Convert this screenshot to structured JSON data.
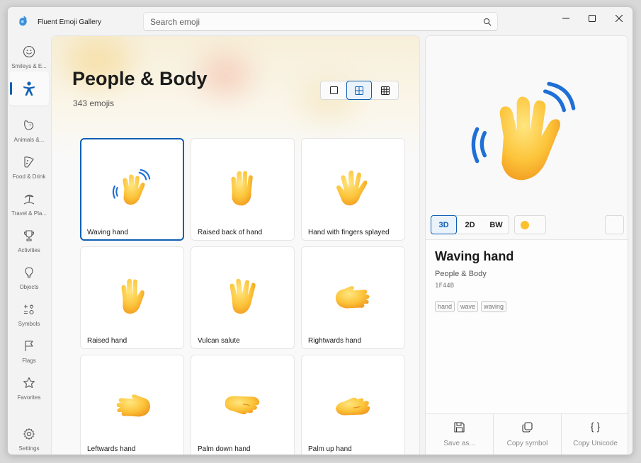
{
  "window": {
    "title": "Fluent Emoji Gallery"
  },
  "search": {
    "placeholder": "Search emoji"
  },
  "nav": {
    "items": [
      {
        "label": "Smileys & E...",
        "icon": "smiley-icon"
      },
      {
        "label": "",
        "icon": "person-icon",
        "active": true
      },
      {
        "label": "Animals &...",
        "icon": "animal-icon"
      },
      {
        "label": "Food & Drink",
        "icon": "food-icon"
      },
      {
        "label": "Travel & Pla...",
        "icon": "travel-icon"
      },
      {
        "label": "Activities",
        "icon": "trophy-icon"
      },
      {
        "label": "Objects",
        "icon": "lightbulb-icon"
      },
      {
        "label": "Symbols",
        "icon": "symbols-icon"
      },
      {
        "label": "Flags",
        "icon": "flag-icon"
      },
      {
        "label": "Favorites",
        "icon": "star-icon"
      }
    ],
    "settings_label": "Settings"
  },
  "main": {
    "title": "People & Body",
    "count": "343 emojis",
    "view_modes": [
      "large-view-icon",
      "medium-view-icon",
      "small-view-icon"
    ],
    "selected_view": "medium",
    "emojis": [
      {
        "label": "Waving hand",
        "icon": "waving-hand-icon",
        "selected": true
      },
      {
        "label": "Raised back of hand",
        "icon": "raised-back-of-hand-icon"
      },
      {
        "label": "Hand with fingers splayed",
        "icon": "hand-fingers-splayed-icon"
      },
      {
        "label": "Raised hand",
        "icon": "raised-hand-icon"
      },
      {
        "label": "Vulcan salute",
        "icon": "vulcan-salute-icon"
      },
      {
        "label": "Rightwards hand",
        "icon": "rightwards-hand-icon"
      },
      {
        "label": "Leftwards hand",
        "icon": "leftwards-hand-icon"
      },
      {
        "label": "Palm down hand",
        "icon": "palm-down-hand-icon"
      },
      {
        "label": "Palm up hand",
        "icon": "palm-up-hand-icon"
      }
    ]
  },
  "details": {
    "styles": [
      "3D",
      "2D",
      "BW"
    ],
    "selected_style": "3D",
    "skin_tone_color": "#fbc02d",
    "name": "Waving hand",
    "group": "People & Body",
    "code": "1F44B",
    "tags": [
      "hand",
      "wave",
      "waving"
    ],
    "actions": [
      {
        "label": "Save as...",
        "icon": "save-icon"
      },
      {
        "label": "Copy symbol",
        "icon": "copy-icon"
      },
      {
        "label": "Copy Unicode",
        "icon": "braces-icon"
      }
    ]
  },
  "colors": {
    "accent": "#0f5fb3",
    "emoji_yellow": "#fbc02d"
  }
}
